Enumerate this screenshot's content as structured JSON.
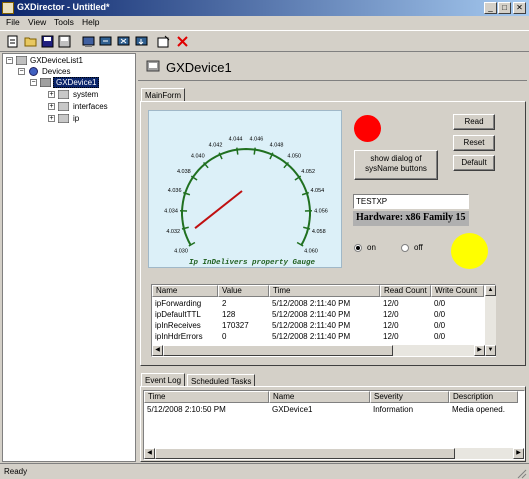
{
  "window": {
    "title": "GXDirector - Untitled*"
  },
  "menu": [
    "File",
    "View",
    "Tools",
    "Help"
  ],
  "toolbar_icons": [
    "new-icon",
    "open-icon",
    "save-icon",
    "save-as-icon",
    "device-icon",
    "connect-icon",
    "disconnect-icon",
    "read-icon",
    "properties-icon",
    "delete-icon"
  ],
  "tree": {
    "root": "GXDeviceList1",
    "devices": "Devices",
    "device": "GXDevice1",
    "children": [
      "system",
      "interfaces",
      "ip"
    ]
  },
  "device_header": {
    "title": "GXDevice1"
  },
  "main_tab": "MainForm",
  "gauge": {
    "label": "Ip InDelivers property Gauge",
    "ticks": [
      "4.030",
      "4.032",
      "4.034",
      "4.036",
      "4.038",
      "4.040",
      "4.042",
      "4.044",
      "4.046",
      "4.048",
      "4.050",
      "4.052",
      "4.054",
      "4.056",
      "4.058",
      "4.060"
    ],
    "value_fraction": 0.05
  },
  "buttons": {
    "read": "Read",
    "reset": "Reset",
    "default": "Default",
    "show_dialog": "show dialog of sysName buttons"
  },
  "sysname_field": "TESTXP",
  "hardware_label": "Hardware: x86 Family 15",
  "radio": {
    "on": "on",
    "off": "off",
    "selected": "on"
  },
  "indicators": {
    "red": "#ff0000",
    "yellow": "#ffff00"
  },
  "props_table": {
    "columns": [
      "Name",
      "Value",
      "Time",
      "Read Count",
      "Write Count"
    ],
    "rows": [
      [
        "ipForwarding",
        "2",
        "5/12/2008 2:11:40 PM",
        "12/0",
        "0/0"
      ],
      [
        "ipDefaultTTL",
        "128",
        "5/12/2008 2:11:40 PM",
        "12/0",
        "0/0"
      ],
      [
        "ipInReceives",
        "170327",
        "5/12/2008 2:11:40 PM",
        "12/0",
        "0/0"
      ],
      [
        "ipInHdrErrors",
        "0",
        "5/12/2008 2:11:40 PM",
        "12/0",
        "0/0"
      ]
    ]
  },
  "bottom_tabs": [
    "Event Log",
    "Scheduled Tasks"
  ],
  "event_table": {
    "columns": [
      "Time",
      "Name",
      "Severity",
      "Description"
    ],
    "rows": [
      [
        "5/12/2008 2:10:50 PM",
        "GXDevice1",
        "Information",
        "Media opened."
      ]
    ]
  },
  "status": "Ready"
}
